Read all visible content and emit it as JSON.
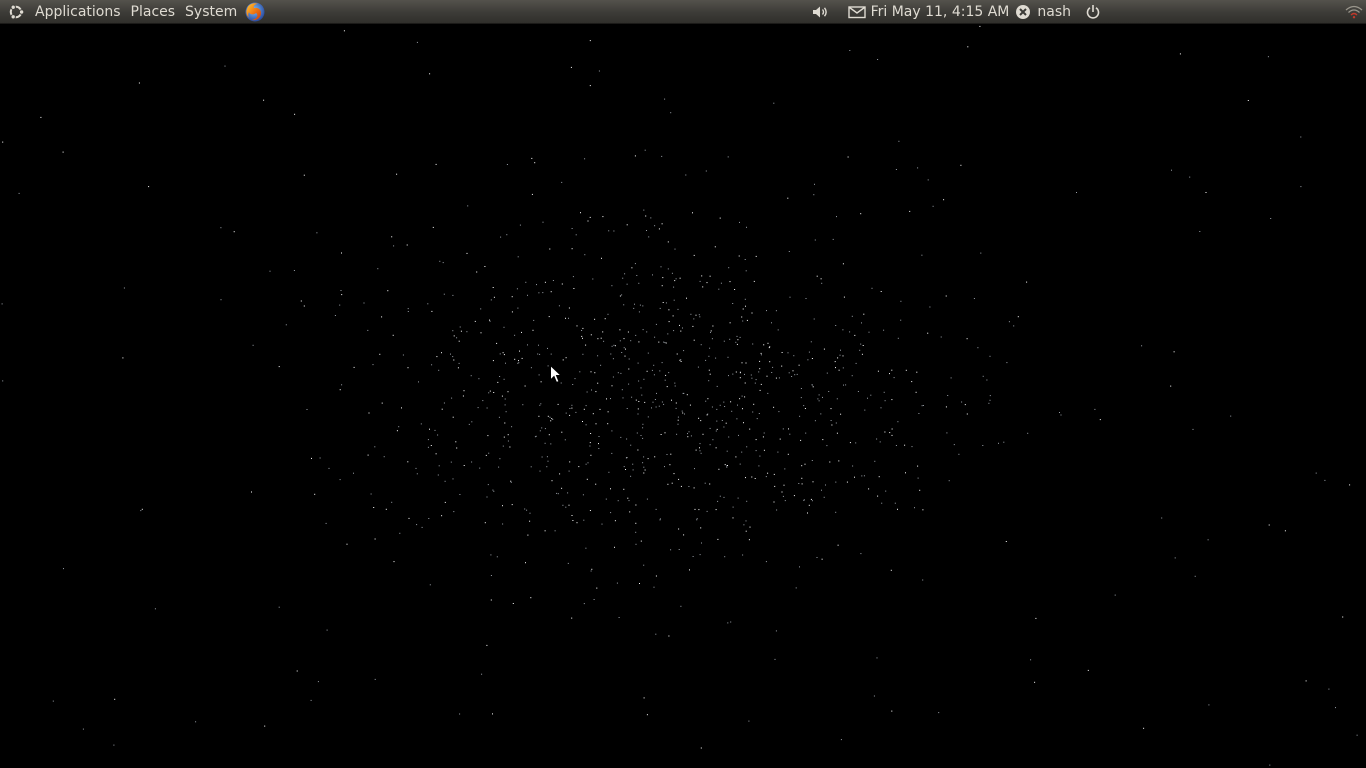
{
  "panel": {
    "menus": {
      "applications": "Applications",
      "places": "Places",
      "system": "System"
    },
    "icons": {
      "main_menu": "ubuntu-logo-icon",
      "browser_launcher": "firefox-icon",
      "volume": "volume-icon",
      "messaging": "envelope-icon",
      "user_status": "offline-status-icon",
      "session": "power-icon",
      "network": "wifi-icon"
    },
    "clock": "Fri May 11,  4:15 AM",
    "username": "nash"
  },
  "desktop": {
    "wallpaper": "starfield",
    "background_color": "#000000",
    "cursor": "arrow-pointer"
  },
  "colors": {
    "panel_top": "#54524c",
    "panel_bottom": "#302f2b",
    "panel_text": "#dfdbd2",
    "firefox_orange": "#e66000",
    "firefox_blue": "#3b5aa6"
  }
}
